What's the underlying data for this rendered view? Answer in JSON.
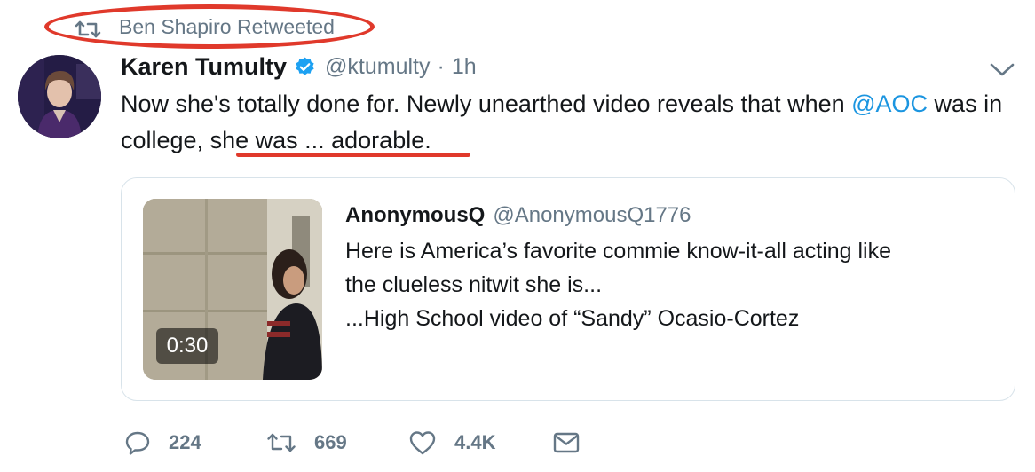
{
  "retweet_context": {
    "label": "Ben Shapiro Retweeted"
  },
  "tweet": {
    "author_name": "Karen Tumulty",
    "handle": "@ktumulty",
    "separator": "·",
    "time": "1h",
    "text_part1": "Now she's totally done for. Newly unearthed video reveals that when ",
    "mention": "@AOC",
    "text_part2": " was in college, ",
    "text_part3": "she was ... adorable."
  },
  "quoted_tweet": {
    "author_name": "AnonymousQ",
    "handle": "@AnonymousQ1776",
    "line1": "Here is America’s favorite commie know-it-all acting like",
    "line2": "the clueless nitwit she is...",
    "line3": "...High School video of “Sandy” Ocasio-Cortez",
    "video_duration": "0:30"
  },
  "actions": {
    "reply_count": "224",
    "retweet_count": "669",
    "like_count": "4.4K"
  },
  "colors": {
    "annotation_red": "#e0392b",
    "link_blue": "#1b95e0",
    "muted_gray": "#657786",
    "verified_blue": "#1da1f2"
  },
  "icons": [
    "retweet-icon",
    "verified-badge-icon",
    "chevron-down-icon",
    "reply-icon",
    "like-icon",
    "direct-message-icon"
  ]
}
